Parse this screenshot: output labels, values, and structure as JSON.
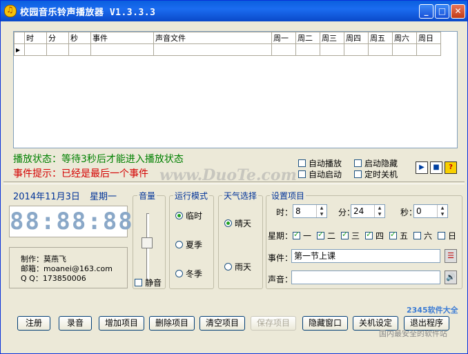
{
  "window": {
    "title": "校园音乐铃声播放器 V1.3.3.3",
    "controls": {
      "minimize": "_",
      "maximize": "□",
      "close": "✕"
    }
  },
  "grid": {
    "columns": [
      "时",
      "分",
      "秒",
      "事件",
      "声音文件",
      "周一",
      "周二",
      "周三",
      "周四",
      "周五",
      "周六",
      "周日"
    ],
    "row_marker": "▶"
  },
  "status": {
    "play_status": "播放状态：等待3秒后才能进入播放状态",
    "event_tip": "事件提示：已经是最后一个事件"
  },
  "options": {
    "auto_play": {
      "label": "自动播放",
      "checked": false
    },
    "auto_start": {
      "label": "自动启动",
      "checked": false
    },
    "start_hidden": {
      "label": "启动隐藏",
      "checked": false
    },
    "timed_shutdown": {
      "label": "定时关机",
      "checked": false
    }
  },
  "mini_buttons": {
    "play": "▶",
    "stop": "■",
    "help": "?"
  },
  "date": {
    "date": "2014年11月3日",
    "weekday": "星期一"
  },
  "clock": {
    "display": "88:88:88"
  },
  "info": {
    "author": "制作：莫燕飞",
    "email": "邮箱：moanei@163.com",
    "qq": "Q Q：173850006"
  },
  "volume": {
    "legend": "音量",
    "mute_label": "静音",
    "mute_checked": false
  },
  "run_mode": {
    "legend": "运行模式",
    "options": [
      "临时",
      "夏季",
      "冬季"
    ],
    "selected": "临时"
  },
  "weather": {
    "legend": "天气选择",
    "options": [
      "晴天",
      "雨天"
    ],
    "selected": "晴天"
  },
  "settings": {
    "legend": "设置项目",
    "hour_label": "时：",
    "hour_value": "8",
    "minute_label": "分：",
    "minute_value": "24",
    "second_label": "秒：",
    "second_value": "0",
    "weekday_label": "星期：",
    "weekdays": [
      {
        "label": "一",
        "checked": true
      },
      {
        "label": "二",
        "checked": true
      },
      {
        "label": "三",
        "checked": true
      },
      {
        "label": "四",
        "checked": true
      },
      {
        "label": "五",
        "checked": true
      },
      {
        "label": "六",
        "checked": false
      },
      {
        "label": "日",
        "checked": false
      }
    ],
    "event_label": "事件：",
    "event_value": "第一节上课",
    "sound_label": "声音：",
    "sound_value": ""
  },
  "buttons": {
    "register": "注册",
    "record": "录音",
    "add": "增加项目",
    "delete": "删除项目",
    "clear": "清空项目",
    "save": "保存项目",
    "hide": "隐藏窗口",
    "shutdown_settings": "关机设定",
    "exit": "退出程序"
  },
  "watermarks": {
    "duote": "www.DuoTe.com",
    "site_2345": "2345软件大全",
    "site_2345_sub": "国内最安全的软件站"
  }
}
